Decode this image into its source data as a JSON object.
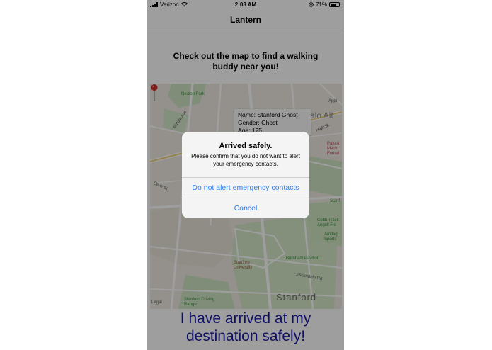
{
  "status_bar": {
    "carrier": "Verizon",
    "time": "2:03 AM",
    "battery": "71%",
    "battery_level": 0.71
  },
  "nav": {
    "title": "Lantern"
  },
  "headline": "Check out the map to find a walking buddy near you!",
  "map": {
    "labels": {
      "nealon_park": "Nealon Park",
      "palo_alto": "alo Alt",
      "apple": "Appl",
      "middle_ave": "Middle Ave",
      "olive_st": "Olive St",
      "stanford_university": "Stanford University",
      "burnham_pavilion": "Burnham Pavilion",
      "stanford": "Stanford",
      "stanford_driving_range": "Stanford Driving Range",
      "cobb_track": "Cobb Track Angell Fie",
      "arrillaga": "Arrillag Sports",
      "palo_alto_medical": "Palo A Medic Found",
      "stan": "Stanf",
      "legal": "Legal",
      "escondido": "Escondido Rd",
      "high_st": "High St"
    },
    "callout": {
      "name": "Name: Stanford Ghost",
      "gender": "Gender: Ghost",
      "age": "Age: 125"
    }
  },
  "bottom_text": "I have arrived at my destination safely!",
  "alert": {
    "title": "Arrived safely.",
    "message": "Please confirm that you do not want to alert your emergency contacts.",
    "primary_button": "Do not alert emergency contacts",
    "cancel_button": "Cancel"
  },
  "colors": {
    "accent": "#2d7ff0",
    "bottom_text": "#1a1aa8",
    "pin": "#d42a2a"
  }
}
